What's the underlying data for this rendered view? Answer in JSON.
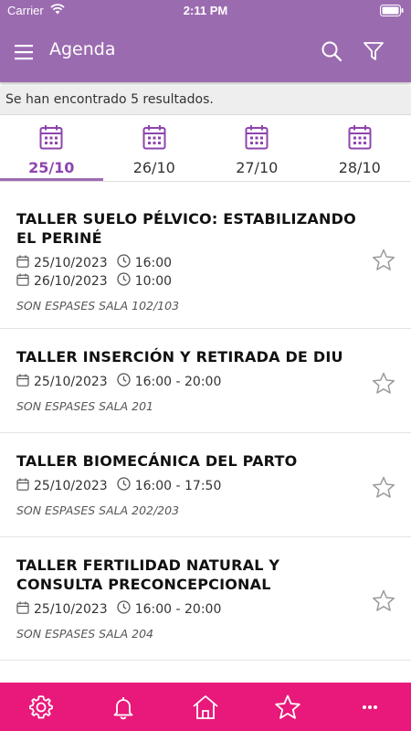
{
  "status_bar": {
    "carrier": "Carrier",
    "time": "2:11 PM"
  },
  "app_bar": {
    "title": "Agenda"
  },
  "results_text": "Se han encontrado 5 resultados.",
  "tabs": [
    {
      "date": "25/10",
      "active": true
    },
    {
      "date": "26/10",
      "active": false
    },
    {
      "date": "27/10",
      "active": false
    },
    {
      "date": "28/10",
      "active": false
    }
  ],
  "events": [
    {
      "title": "TALLER SUELO PÉLVICO: ESTABILIZANDO EL PERINÉ",
      "dates": [
        {
          "date": "25/10/2023",
          "time": "16:00"
        },
        {
          "date": "26/10/2023",
          "time": "10:00"
        }
      ],
      "location": "SON ESPASES SALA 102/103"
    },
    {
      "title": "TALLER INSERCIÓN Y RETIRADA DE DIU",
      "dates": [
        {
          "date": "25/10/2023",
          "time": "16:00 - 20:00"
        }
      ],
      "location": "SON ESPASES SALA 201"
    },
    {
      "title": "TALLER BIOMECÁNICA DEL PARTO",
      "dates": [
        {
          "date": "25/10/2023",
          "time": "16:00 - 17:50"
        }
      ],
      "location": "SON ESPASES SALA 202/203"
    },
    {
      "title": "TALLER FERTILIDAD NATURAL Y CONSULTA PRECONCEPCIONAL",
      "dates": [
        {
          "date": "25/10/2023",
          "time": "16:00 - 20:00"
        }
      ],
      "location": "SON ESPASES SALA 204"
    }
  ],
  "bottom_nav": [
    {
      "icon": "settings-icon"
    },
    {
      "icon": "bell-icon"
    },
    {
      "icon": "home-icon"
    },
    {
      "icon": "star-icon"
    },
    {
      "icon": "more-icon",
      "label": "···"
    }
  ],
  "colors": {
    "header": "#9b6bb0",
    "accent": "#8e44ad",
    "bottom_nav": "#e8197a"
  }
}
